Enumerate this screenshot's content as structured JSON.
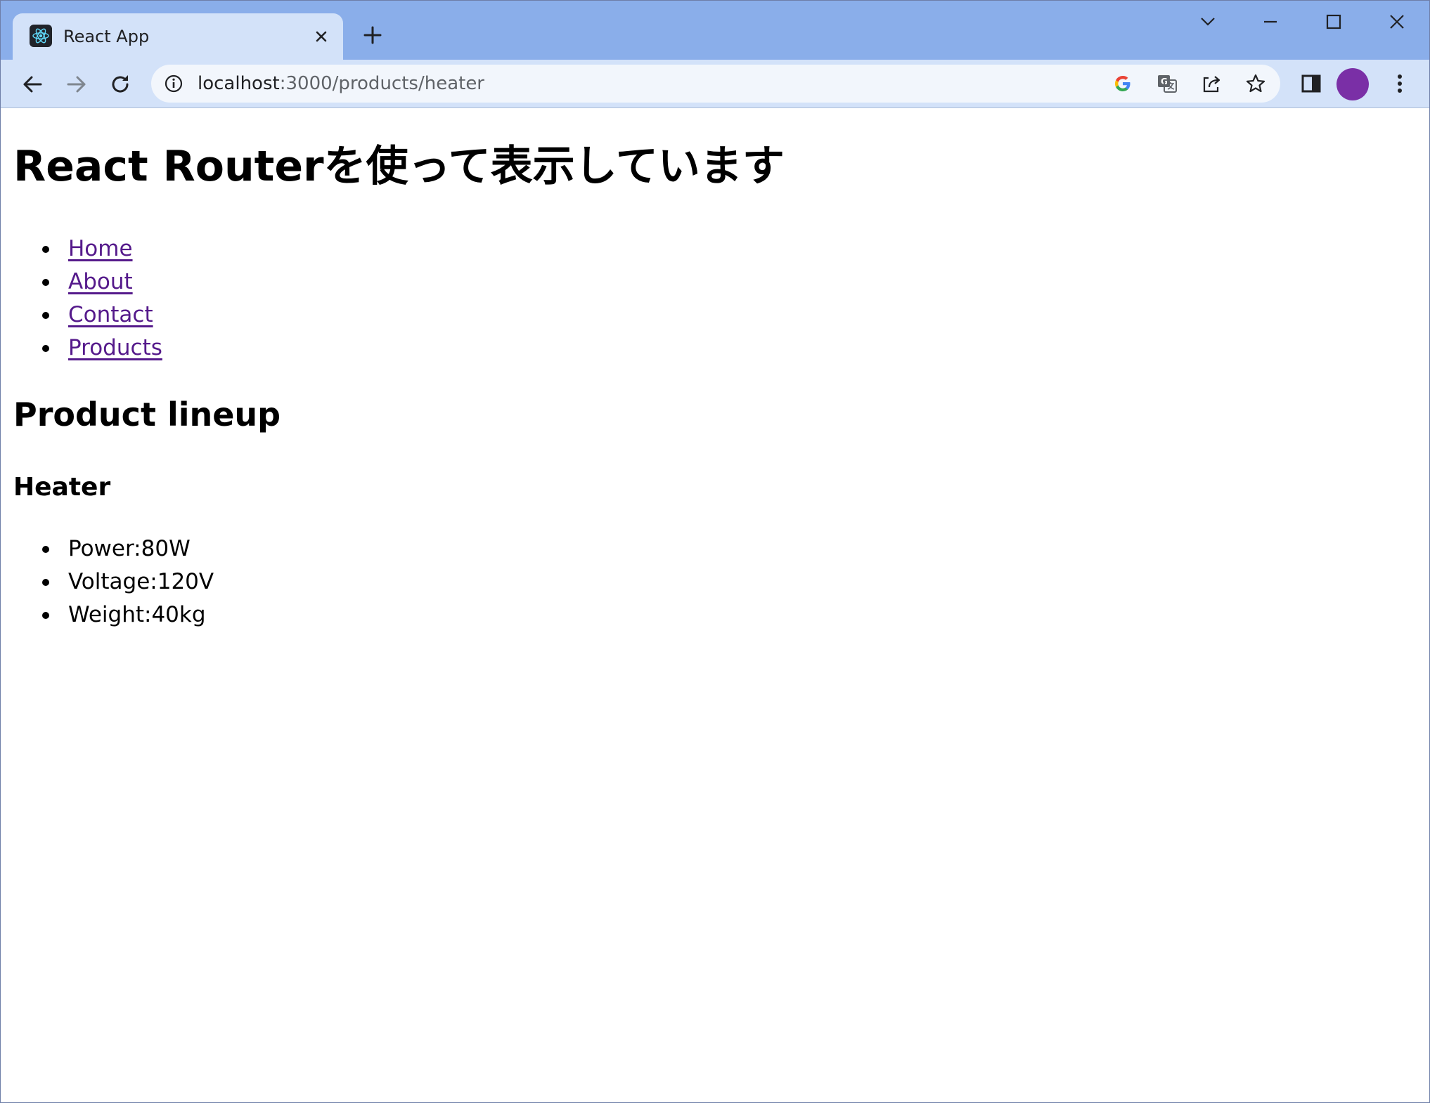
{
  "browser": {
    "tab": {
      "title": "React App",
      "favicon": "react-logo-icon"
    },
    "url": {
      "host": "localhost",
      "path": ":3000/products/heater"
    },
    "avatar_color": "#7a2fa6",
    "tab_strip_color": "#8aaeea",
    "toolbar_color": "#d3e2f9"
  },
  "page": {
    "heading": "React Routerを使って表示しています",
    "nav": [
      {
        "label": "Home"
      },
      {
        "label": "About"
      },
      {
        "label": "Contact"
      },
      {
        "label": "Products"
      }
    ],
    "link_color": "#551a8b",
    "section_title": "Product lineup",
    "product": {
      "name": "Heater",
      "specs": [
        {
          "text": "Power:80W"
        },
        {
          "text": "Voltage:120V"
        },
        {
          "text": "Weight:40kg"
        }
      ]
    }
  }
}
